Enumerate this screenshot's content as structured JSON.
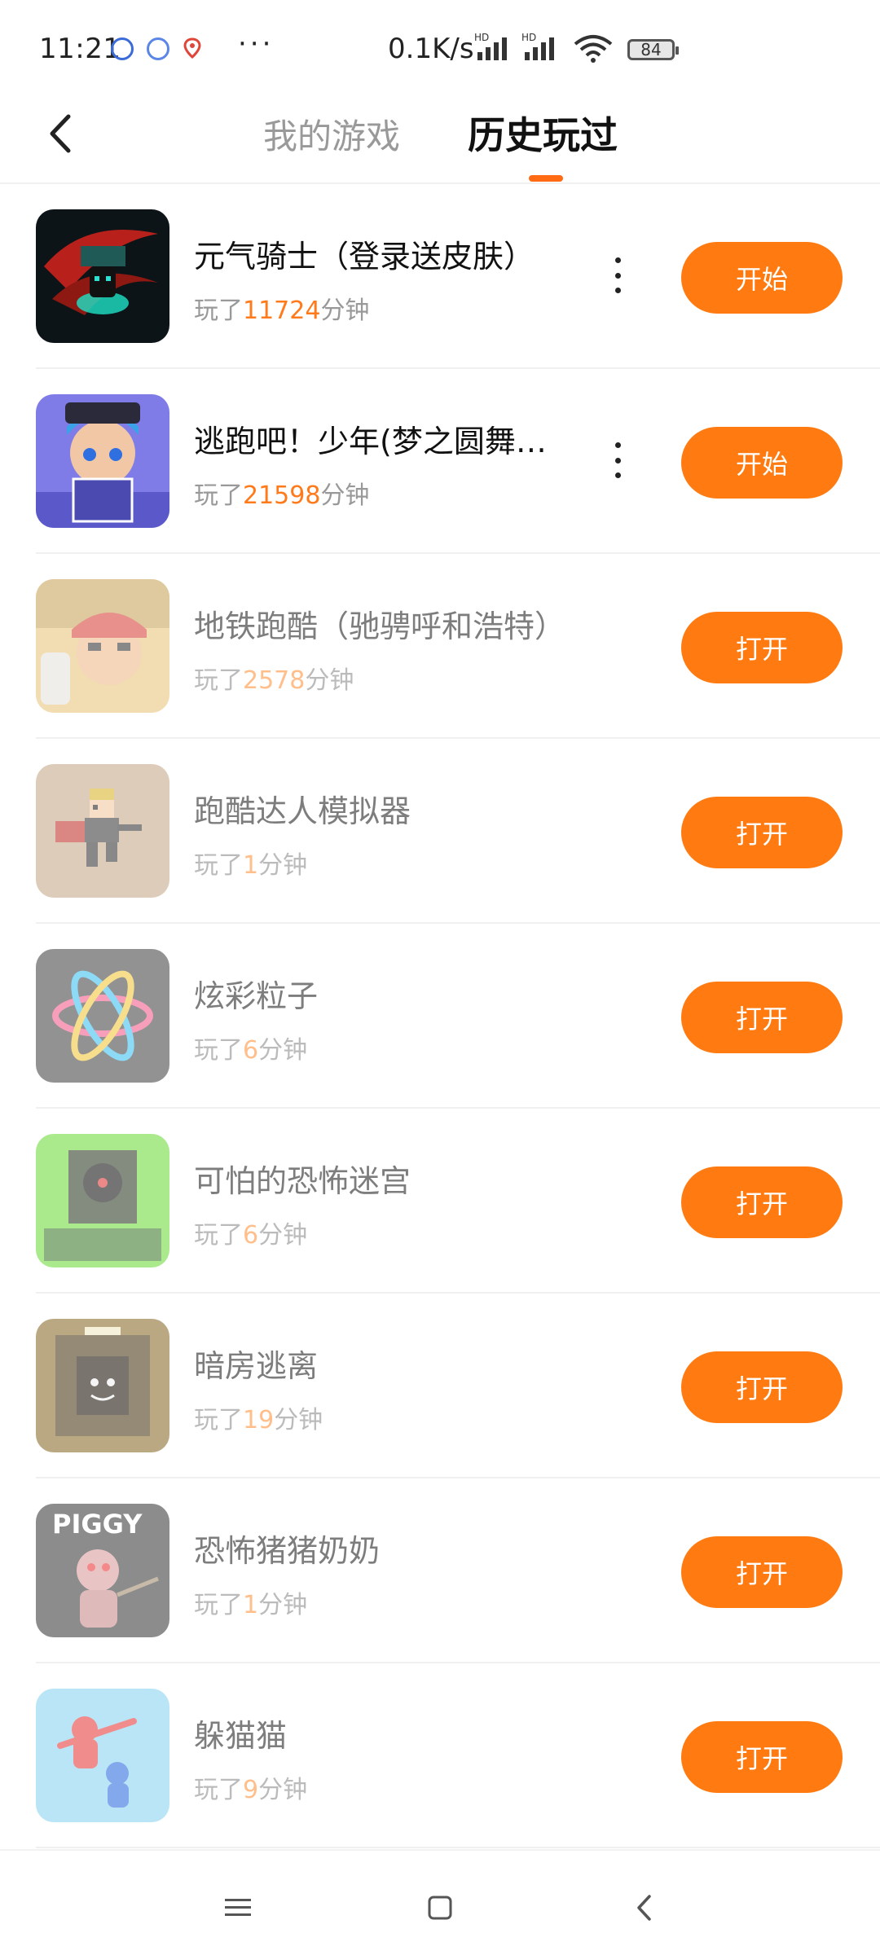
{
  "status_bar": {
    "time": "11:21",
    "more": "···",
    "net_speed": "0.1K/s",
    "battery": "84"
  },
  "header": {
    "tabs": [
      {
        "label": "我的游戏",
        "active": false
      },
      {
        "label": "历史玩过",
        "active": true
      }
    ],
    "accent_color": "#ff6a13"
  },
  "played_prefix": "玩了",
  "played_suffix": "分钟",
  "games": [
    {
      "name": "元气骑士（登录送皮肤）",
      "minutes": "11724",
      "button": "开始",
      "has_menu": true,
      "icon": "soul-knight-icon"
    },
    {
      "name": "逃跑吧！少年(梦之圆舞…",
      "minutes": "21598",
      "button": "开始",
      "has_menu": true,
      "icon": "escape-boy-icon"
    },
    {
      "name": "地铁跑酷（驰骋呼和浩特）",
      "minutes": "2578",
      "button": "打开",
      "has_menu": false,
      "icon": "subway-surfers-icon"
    },
    {
      "name": "跑酷达人模拟器",
      "minutes": "1",
      "button": "打开",
      "has_menu": false,
      "icon": "parkour-simulator-icon"
    },
    {
      "name": "炫彩粒子",
      "minutes": "6",
      "button": "打开",
      "has_menu": false,
      "icon": "atom-particles-icon"
    },
    {
      "name": "可怕的恐怖迷宫",
      "minutes": "6",
      "button": "打开",
      "has_menu": false,
      "icon": "horror-maze-icon"
    },
    {
      "name": "暗房逃离",
      "minutes": "19",
      "button": "打开",
      "has_menu": false,
      "icon": "dark-room-icon"
    },
    {
      "name": "恐怖猪猪奶奶",
      "minutes": "1",
      "button": "打开",
      "has_menu": false,
      "icon": "piggy-icon",
      "icon_text": "PIGGY"
    },
    {
      "name": "躲猫猫",
      "minutes": "9",
      "button": "打开",
      "has_menu": false,
      "icon": "hide-and-seek-icon"
    }
  ],
  "colors": {
    "button": "#ff7a10",
    "minutes_highlight": "#ff7a1a"
  }
}
